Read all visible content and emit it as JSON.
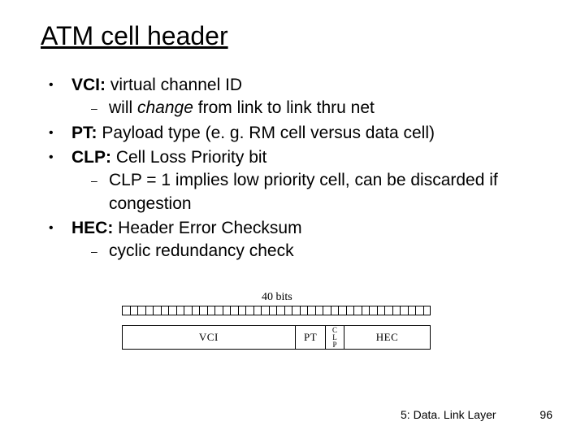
{
  "title": "ATM cell header",
  "bullets": {
    "vci_label": "VCI:",
    "vci_text": " virtual channel ID",
    "vci_sub_a": "will ",
    "vci_sub_b": "change",
    "vci_sub_c": " from link to link thru net",
    "pt_label": "PT:",
    "pt_text": " Payload type (e. g. RM cell versus data cell)",
    "clp_label": "CLP:",
    "clp_text": " Cell Loss Priority bit",
    "clp_sub": "CLP = 1 implies low priority cell, can be discarded if congestion",
    "hec_label": "HEC:",
    "hec_text": " Header Error Checksum",
    "hec_sub": "cyclic redundancy check"
  },
  "diagram": {
    "bits_label": "40 bits",
    "vci": "VCI",
    "pt": "PT",
    "clp_top": "C",
    "clp_mid": "L",
    "clp_bot": "P",
    "hec": "HEC"
  },
  "footer": {
    "chapter": "5: Data. Link Layer",
    "page": "96"
  }
}
